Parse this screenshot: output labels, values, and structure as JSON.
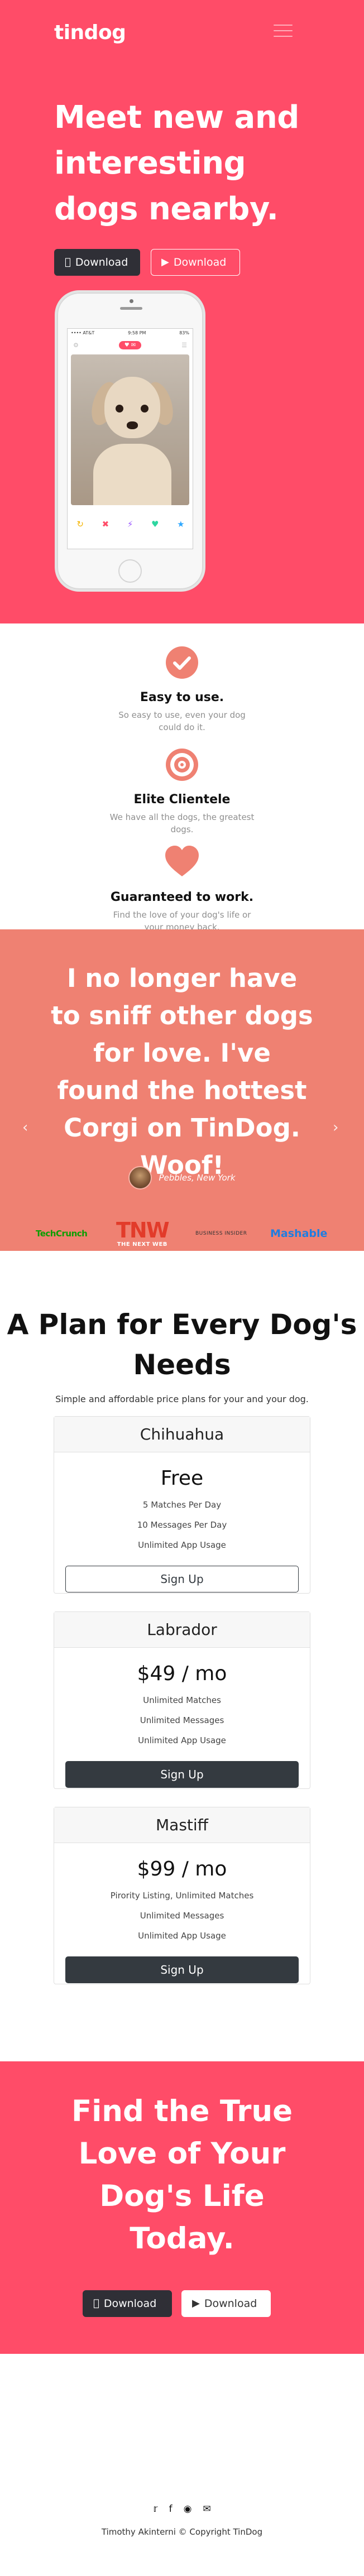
{
  "nav": {
    "brand": "tindog",
    "menu_icon": "hamburger-icon"
  },
  "hero": {
    "heading": "Meet new and interesting dogs nearby.",
    "download_apple": "Download",
    "download_play": "Download",
    "phone": {
      "status_left": "•••• AT&T",
      "status_time": "9:58 PM",
      "status_right": "83%",
      "actions": [
        "↻",
        "✖",
        "⚡",
        "♥",
        "★"
      ]
    }
  },
  "features": [
    {
      "icon": "check-circle-icon",
      "title": "Easy to use.",
      "text": "So easy to use, even your dog could do it."
    },
    {
      "icon": "bullseye-icon",
      "title": "Elite Clientele",
      "text": "We have all the dogs, the greatest dogs."
    },
    {
      "icon": "heart-icon",
      "title": "Guaranteed to work.",
      "text": "Find the love of your dog's life or your money back."
    }
  ],
  "testimonial": {
    "quote": "I no longer have to sniff other dogs for love. I've found the hottest Corgi on TinDog. Woof!",
    "author": "Pebbles, New York",
    "prev": "‹",
    "next": "›"
  },
  "press": {
    "techcrunch": "TechCrunch",
    "tnw": "TNW",
    "tnw_sub": "THE NEXT WEB",
    "business_insider": "BUSINESS INSIDER",
    "mashable": "Mashable"
  },
  "pricing": {
    "title": "A Plan for Every Dog's Needs",
    "subtitle": "Simple and affordable price plans for your and your dog.",
    "plans": [
      {
        "name": "Chihuahua",
        "price": "Free",
        "features": [
          "5 Matches Per Day",
          "10 Messages Per Day",
          "Unlimited App Usage"
        ],
        "button": "Sign Up"
      },
      {
        "name": "Labrador",
        "price": "$49 / mo",
        "features": [
          "Unlimited Matches",
          "Unlimited Messages",
          "Unlimited App Usage"
        ],
        "button": "Sign Up"
      },
      {
        "name": "Mastiff",
        "price": "$99 / mo",
        "features": [
          "Pirority Listing, Unlimited Matches",
          "Unlimited Messages",
          "Unlimited App Usage"
        ],
        "button": "Sign Up"
      }
    ]
  },
  "cta": {
    "title": "Find the True Love of Your Dog's Life Today.",
    "download_apple": "Download",
    "download_play": "Download"
  },
  "footer": {
    "social_icons": [
      "twitter-icon",
      "facebook-icon",
      "instagram-icon",
      "mail-icon"
    ],
    "copyright": "Timothy Akinterni © Copyright TinDog"
  },
  "colors": {
    "primary": "#ff4c68",
    "testimonial_bg": "#ef8172",
    "dark": "#343a40"
  }
}
